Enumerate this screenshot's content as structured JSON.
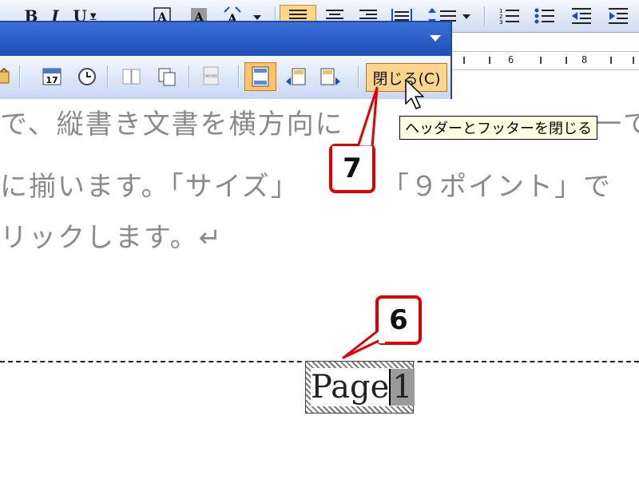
{
  "formatting_toolbar": {
    "bold": "B",
    "italic": "I",
    "underline": "U",
    "icons": [
      "bold-icon",
      "italic-icon",
      "underline-icon",
      "char-border-icon",
      "char-shading-icon",
      "phonetic-guide-icon",
      "align-justify-icon",
      "align-center-icon",
      "align-right-icon",
      "distributed-align-icon",
      "line-spacing-icon",
      "numbering-icon",
      "bullets-icon",
      "decrease-indent-icon",
      "increase-indent-icon"
    ]
  },
  "ruler": {
    "numbers": [
      "6",
      "8"
    ]
  },
  "header_footer_toolbar": {
    "close_button": "閉じる(C)",
    "tooltip": "ヘッダーとフッターを閉じる",
    "icons": [
      "insert-autotext-icon",
      "insert-date-icon",
      "insert-time-icon",
      "page-setup-icon",
      "show-hide-document-text-icon",
      "same-as-previous-icon",
      "switch-header-footer-icon",
      "show-previous-icon",
      "show-next-icon"
    ]
  },
  "document": {
    "lines": [
      "で、縦書き文書を横方向に",
      "に揃います。「サイズ」",
      "リックします。↵"
    ],
    "line1_tail": "一て",
    "line2_tail": "「９ポイント」で",
    "page_number_text": "Page",
    "page_number_field": "1"
  },
  "callouts": {
    "step_6": "6",
    "step_7": "7"
  },
  "colors": {
    "callout": "#e00000",
    "active_button": "#ffd48c",
    "title_bar": "#1f4eb4"
  }
}
